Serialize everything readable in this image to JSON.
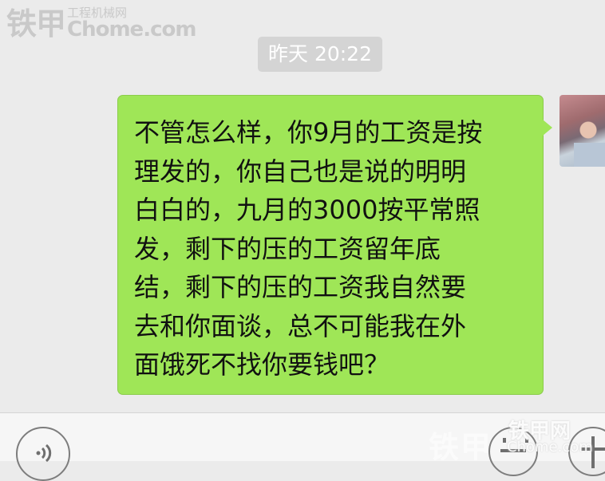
{
  "watermark": {
    "brand": "铁甲",
    "subtitle": "工程机械网",
    "domain": "Chome.com"
  },
  "chat": {
    "timestamp": "昨天 20:22",
    "message_lines": "不管怎么样，你9月的工资是按\n理发的，你自己也是说的明明\n白白的，九月的3000按平常照\n发，剩下的压的工资留年底\n结，剩下的压的工资我自然要\n去和你面谈，总不可能我在外\n面饿死不找你要钱吧？"
  },
  "bottom_watermark": {
    "cn": "铁甲",
    "brand": "铁甲网",
    "domain": "Chome.com"
  },
  "colors": {
    "bubble": "#9fe657",
    "background": "#ebebeb",
    "timestamp_bg": "#d4d4d4"
  },
  "icons": {
    "voice": "voice-icon",
    "emoji": "emoji-icon",
    "plus": "plus-icon"
  }
}
